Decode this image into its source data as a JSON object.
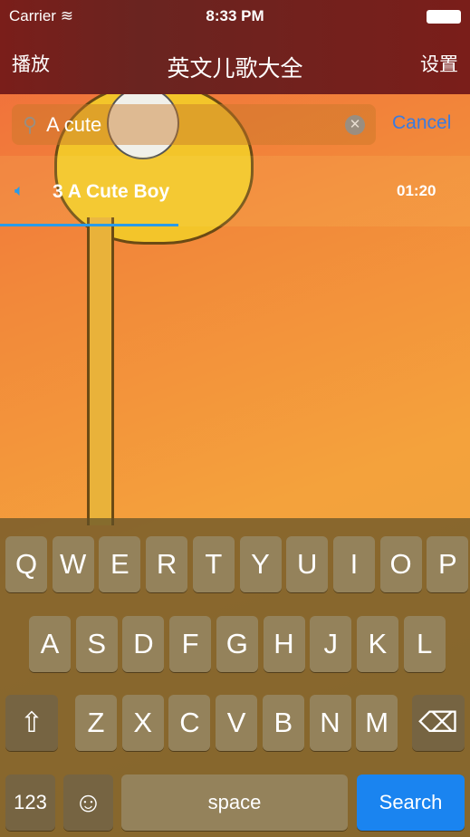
{
  "status": {
    "carrier": "Carrier",
    "time": "8:33 PM"
  },
  "nav": {
    "left": "播放",
    "title": "英文儿歌大全",
    "right": "设置"
  },
  "search": {
    "value": "A cute",
    "cancel": "Cancel"
  },
  "songs": [
    {
      "title": "3 A Cute Boy",
      "duration": "01:20",
      "playing": true,
      "progress_percent": 38
    }
  ],
  "keyboard": {
    "row1": [
      "Q",
      "W",
      "E",
      "R",
      "T",
      "Y",
      "U",
      "I",
      "O",
      "P"
    ],
    "row2": [
      "A",
      "S",
      "D",
      "F",
      "G",
      "H",
      "J",
      "K",
      "L"
    ],
    "row3": [
      "Z",
      "X",
      "C",
      "V",
      "B",
      "N",
      "M"
    ],
    "numbers": "123",
    "space": "space",
    "search": "Search"
  },
  "colors": {
    "accent": "#1a84f0",
    "header": "#7a1e1a"
  }
}
